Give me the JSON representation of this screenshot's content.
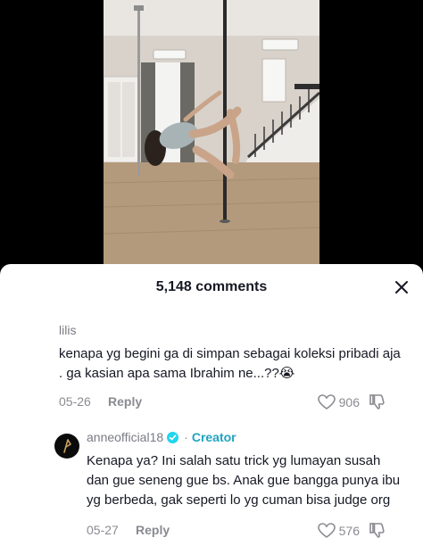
{
  "sheet": {
    "comment_count": "5,148 comments"
  },
  "comments": [
    {
      "username": "lilis",
      "text": "kenapa yg begini ga di simpan sebagai koleksi pribadi aja . ga kasian apa sama Ibrahim ne...??😭",
      "date": "05-26",
      "reply_label": "Reply",
      "likes": "906"
    },
    {
      "username": "anneofficial18",
      "badge_icon": "verified-icon",
      "creator_label": "Creator",
      "creator_separator": "·",
      "text": "Kenapa ya? Ini salah satu trick yg lumayan susah dan gue seneng gue bs. Anak gue bangga punya ibu yg berbeda, gak seperti lo yg cuman bisa judge org",
      "date": "05-27",
      "reply_label": "Reply",
      "likes": "576"
    }
  ],
  "colors": {
    "text": "#161823",
    "muted": "#8a8b91",
    "creator": "#20a4bf",
    "verified": "#20d5ec"
  }
}
